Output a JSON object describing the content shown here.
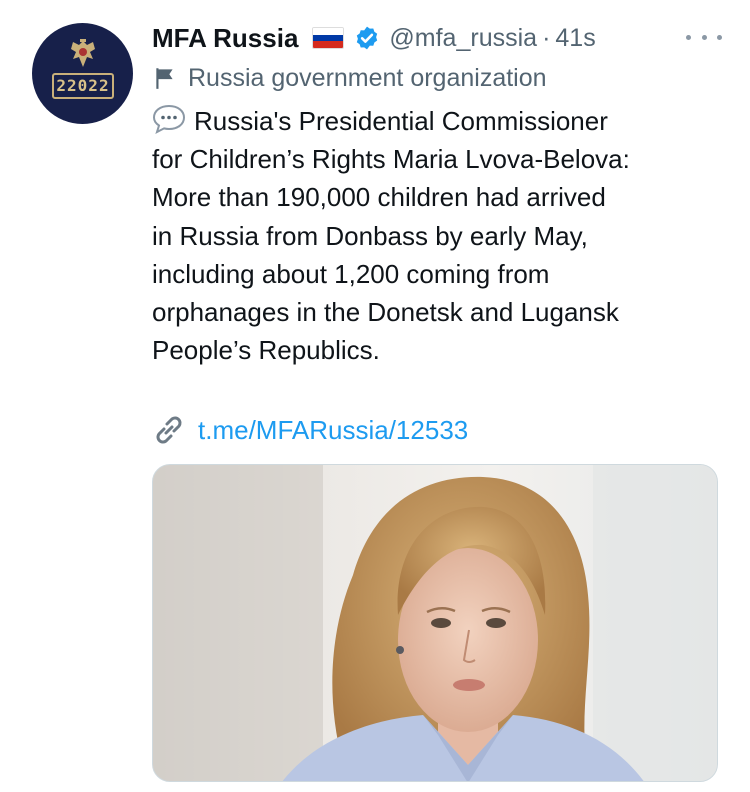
{
  "account": {
    "name": "MFA Russia",
    "handle": "@mfa_russia",
    "separator": "·",
    "timestamp": "41s",
    "avatar_badge": "22022",
    "flag_colors": [
      "#ffffff",
      "#0039a6",
      "#d52b1e"
    ],
    "verified_color": "#1d9bf0"
  },
  "label": {
    "icon": "flag-icon",
    "text": "Russia government organization"
  },
  "tweet": {
    "icon": "speech-bubble-icon",
    "text": "Russia's Presidential Commissioner\nfor Children’s Rights Maria Lvova-Belova:\nMore than 190,000 children had arrived\nin Russia from Donbass by early May,\nincluding about 1,200 coming from\norphanages in the Donetsk and Lugansk\nPeople’s Republics.",
    "link_icon": "link-icon",
    "link": "t.me/MFARussia/12533"
  },
  "more_icon": "more-options-icon",
  "colors": {
    "link": "#1d9bf0",
    "secondary_text": "#536471",
    "primary_text": "#0f1419"
  }
}
